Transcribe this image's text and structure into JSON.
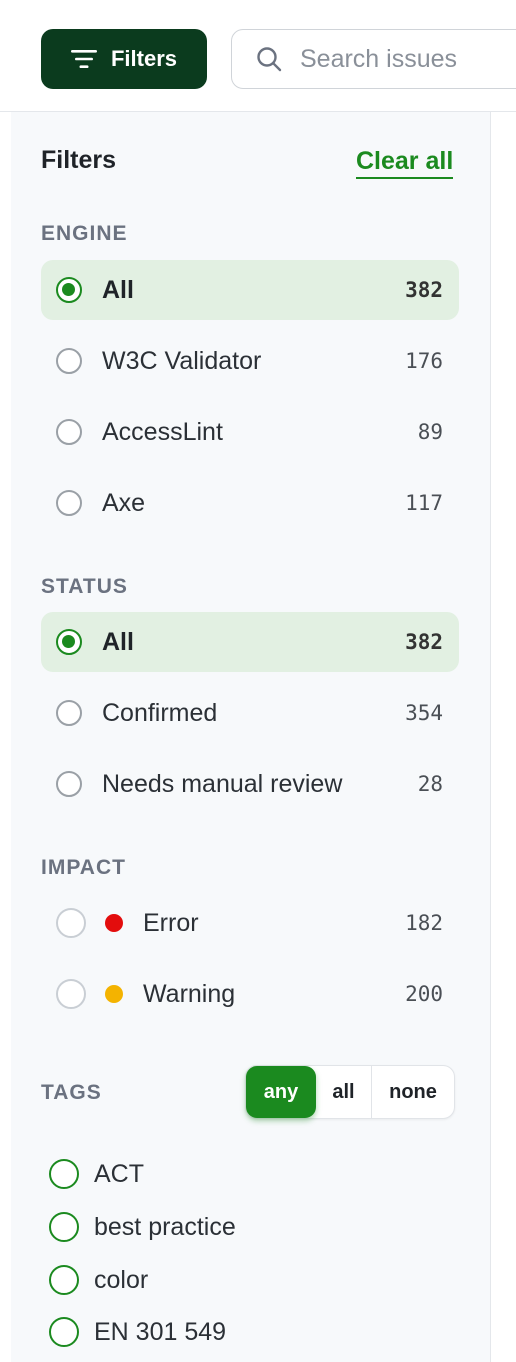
{
  "toolbar": {
    "filters_label": "Filters",
    "search_placeholder": "Search issues"
  },
  "panel": {
    "title": "Filters",
    "clear_all": "Clear all"
  },
  "engine": {
    "title": "ENGINE",
    "options": [
      {
        "label": "All",
        "count": "382",
        "selected": true
      },
      {
        "label": "W3C Validator",
        "count": "176",
        "selected": false
      },
      {
        "label": "AccessLint",
        "count": "89",
        "selected": false
      },
      {
        "label": "Axe",
        "count": "117",
        "selected": false
      }
    ]
  },
  "status": {
    "title": "STATUS",
    "options": [
      {
        "label": "All",
        "count": "382",
        "selected": true
      },
      {
        "label": "Confirmed",
        "count": "354",
        "selected": false
      },
      {
        "label": "Needs manual review",
        "count": "28",
        "selected": false
      }
    ]
  },
  "impact": {
    "title": "IMPACT",
    "options": [
      {
        "label": "Error",
        "count": "182",
        "color": "#e30d0d"
      },
      {
        "label": "Warning",
        "count": "200",
        "color": "#f4b300"
      }
    ]
  },
  "tags": {
    "title": "TAGS",
    "match_modes": [
      {
        "label": "any",
        "active": true
      },
      {
        "label": "all",
        "active": false
      },
      {
        "label": "none",
        "active": false
      }
    ],
    "items": [
      {
        "label": "ACT"
      },
      {
        "label": "best practice"
      },
      {
        "label": "color"
      },
      {
        "label": "EN 301 549"
      }
    ]
  },
  "colors": {
    "accent": "#1b8a1f",
    "primary_button": "#0b3b1e",
    "selected_row": "#e2f0e2"
  }
}
